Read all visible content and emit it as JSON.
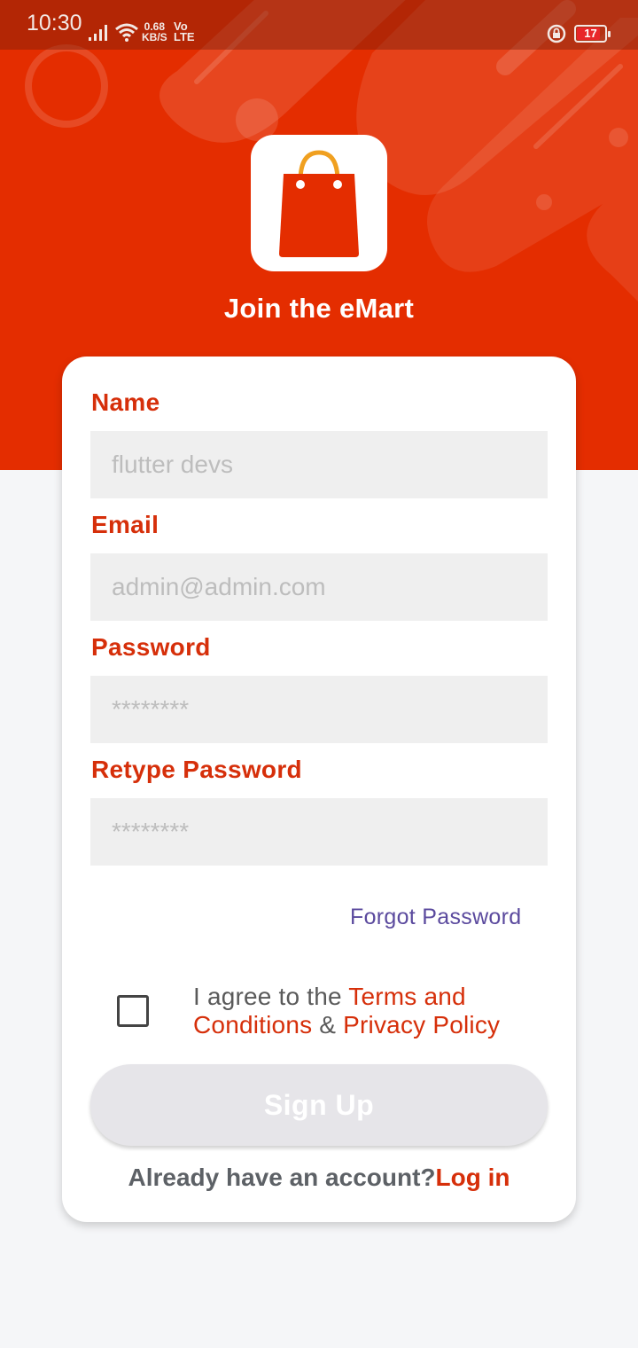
{
  "status_bar": {
    "time": "10:30",
    "speed_value": "0.68",
    "speed_unit": "KB/S",
    "network_vo": "Vo",
    "network_lte": "LTE",
    "battery": "17",
    "icons": [
      "signal-icon",
      "wifi-icon",
      "rotation-lock-icon",
      "battery-icon"
    ]
  },
  "header": {
    "app_title": "Join the eMart",
    "logo_icon": "shopping-bag-icon",
    "background_color": "#e42d00"
  },
  "form": {
    "name": {
      "label": "Name",
      "placeholder": "flutter devs",
      "value": ""
    },
    "email": {
      "label": "Email",
      "placeholder": "admin@admin.com",
      "value": ""
    },
    "password": {
      "label": "Password",
      "placeholder": "********",
      "value": ""
    },
    "retype_password": {
      "label": "Retype Password",
      "placeholder": "********",
      "value": ""
    },
    "forgot_password": "Forgot Password",
    "agree_prefix": "I agree to the ",
    "terms_link": "Terms and Conditions",
    "agree_and": " & ",
    "privacy_link": "Privacy Policy",
    "agree_checked": false,
    "signup_label": "Sign Up",
    "have_account": "Already have an account?",
    "login_link": "Log in"
  },
  "colors": {
    "accent": "#d62f0a",
    "link_purple": "#5b4a9e",
    "field_bg": "#efefef",
    "button_disabled": "#e6e5e9"
  }
}
